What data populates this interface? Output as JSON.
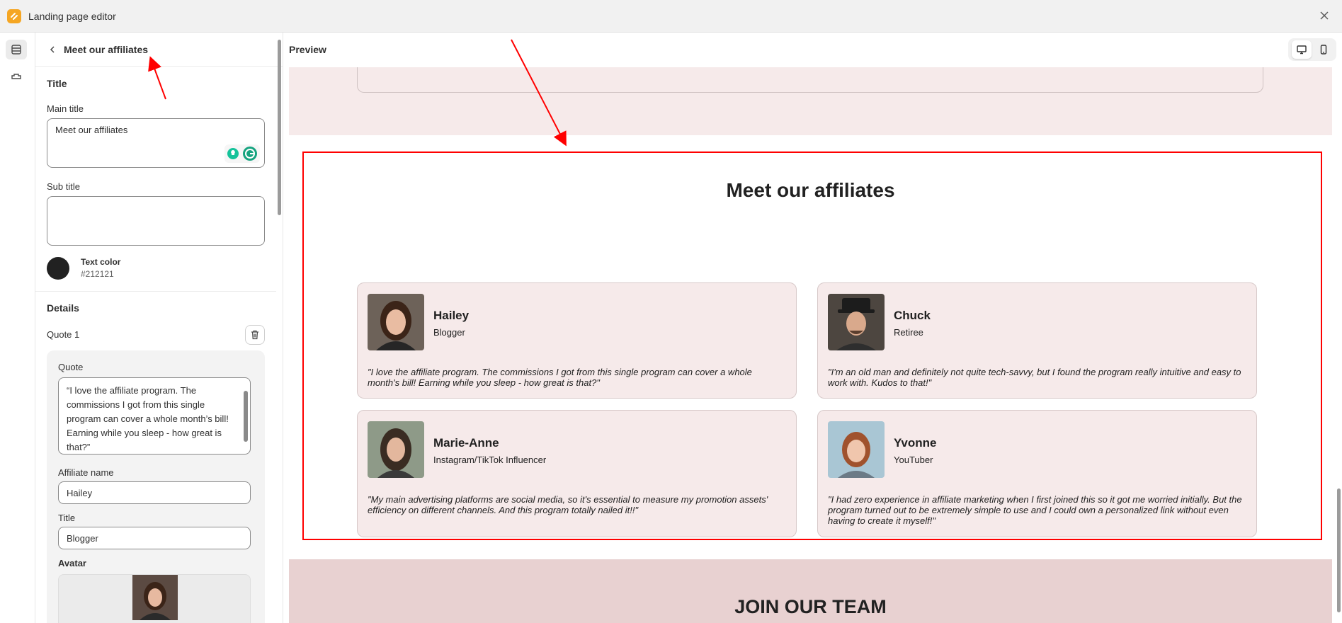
{
  "app": {
    "title": "Landing page editor"
  },
  "panel": {
    "header_title": "Meet our affiliates",
    "title_section": {
      "heading": "Title",
      "main_title_label": "Main title",
      "main_title_value": "Meet our affiliates",
      "sub_title_label": "Sub title",
      "sub_title_value": "",
      "text_color_label": "Text color",
      "text_color_value": "#212121"
    },
    "details_section": {
      "heading": "Details",
      "quote_item_label": "Quote 1",
      "quote_label": "Quote",
      "quote_value": "“I love the affiliate program. The commissions I got from this single program can cover a whole month’s bill! Earning while you sleep - how great is that?”",
      "affiliate_name_label": "Affiliate name",
      "affiliate_name_value": "Hailey",
      "title_label": "Title",
      "title_value": "Blogger",
      "avatar_label": "Avatar"
    }
  },
  "preview": {
    "label": "Preview",
    "section_title": "Meet our affiliates",
    "next_section_title": "JOIN OUR TEAM",
    "affiliates": [
      {
        "name": "Hailey",
        "role": "Blogger",
        "quote": "\"I love the affiliate program. The commissions I got from this single program can cover a whole month's bill! Earning while you sleep - how great is that?\""
      },
      {
        "name": "Chuck",
        "role": "Retiree",
        "quote": "\"I'm an old man and definitely not quite tech-savvy, but I found the program really intuitive and easy to work with. Kudos to that!\""
      },
      {
        "name": "Marie-Anne",
        "role": "Instagram/TikTok Influencer",
        "quote": "\"My main advertising platforms are social media, so it's essential to measure my promotion assets' efficiency on different channels. And this program totally nailed it!!\""
      },
      {
        "name": "Yvonne",
        "role": "YouTuber",
        "quote": "\"I had zero experience in affiliate marketing when I first joined this so it got me worried initially. But the program turned out to be extremely simple to use and I could own a personalized link without even having to create it myself!\""
      }
    ]
  },
  "icons": {
    "app_logo": "app-logo-icon",
    "close": "close-icon",
    "sections": "sections-icon",
    "theme": "theme-icon",
    "back": "chevron-left-icon",
    "trash": "trash-icon",
    "desktop": "desktop-icon",
    "mobile": "mobile-icon"
  },
  "colors": {
    "annotation": "#ff0000",
    "card_bg": "#f6eaea",
    "join_band": "#e8d1d1",
    "text_dark": "#212121"
  }
}
